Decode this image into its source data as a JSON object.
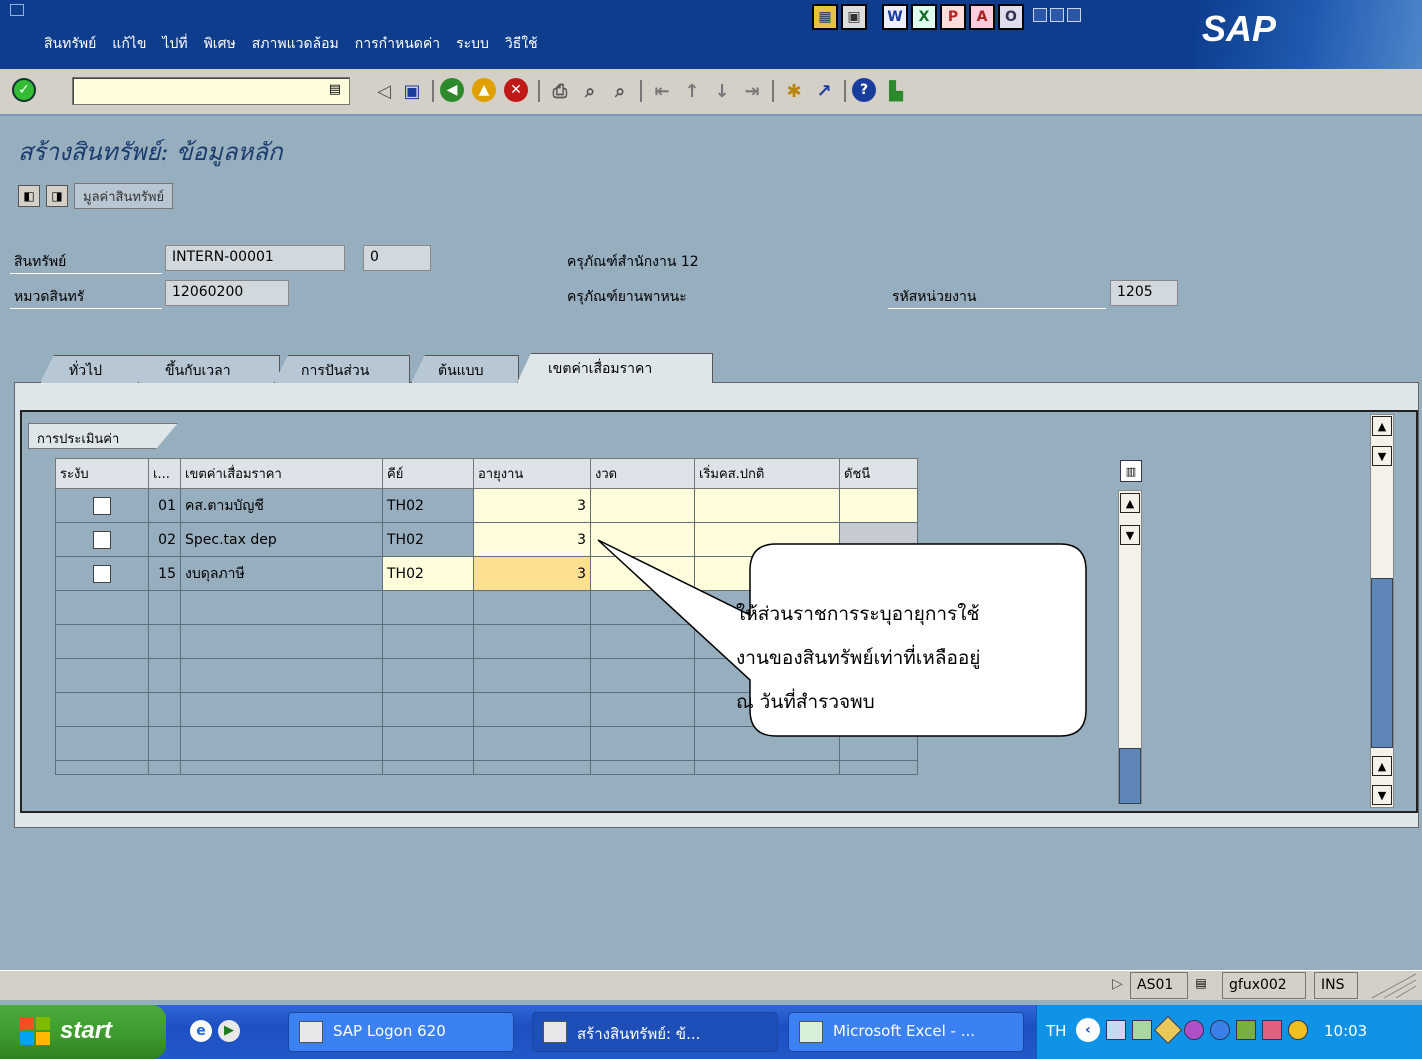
{
  "menubar": {
    "items": [
      "สินทรัพย์",
      "แก้ไข",
      "ไปที่",
      "พิเศษ",
      "สภาพแวดล้อม",
      "การกำหนดค่า",
      "ระบบ",
      "วิธีใช้"
    ],
    "logo": "SAP"
  },
  "system_toolbar": {
    "command_value": "",
    "icons": [
      "enter-icon",
      "back-icon",
      "save-icon",
      "back-green-icon",
      "exit-icon",
      "cancel-icon",
      "print-icon",
      "find-icon",
      "find-next-icon",
      "first-page-icon",
      "prev-page-icon",
      "next-page-icon",
      "last-page-icon",
      "new-session-icon",
      "shortcut-icon",
      "help-icon",
      "layout-icon"
    ]
  },
  "page": {
    "title": "สร้างสินทรัพย์: ข้อมูลหลัก",
    "app_button_label": "มูลค่าสินทรัพย์"
  },
  "header": {
    "asset_label": "สินทรัพย์",
    "asset_value": "INTERN-00001",
    "sub_number": "0",
    "description": "ครุภัณฑ์สำนักงาน 12",
    "class_label": "หมวดสินทรั",
    "class_value": "12060200",
    "class_description": "ครุภัณฑ์ยานพาหนะ",
    "cost_center_label": "รหัสหน่วยงาน",
    "cost_center_value": "1205"
  },
  "tabs": [
    "ทั่วไป",
    "ขึ้นกับเวลา",
    "การปันส่วน",
    "ต้นแบบ",
    "เขตค่าเสื่อมราคา"
  ],
  "active_tab": "เขตค่าเสื่อมราคา",
  "valuation": {
    "group_label": "การประเมินค่า",
    "columns": [
      "ระงับ",
      "เ...",
      "เขตค่าเสื่อมราคา",
      "คีย์",
      "อายุงาน",
      "งวด",
      "เริ่มคส.ปกติ",
      "ดัชนี"
    ],
    "rows": [
      {
        "area": "01",
        "name": "คส.ตามบัญชี",
        "key": "TH02",
        "life": "3",
        "period": "",
        "start": "",
        "index": ""
      },
      {
        "area": "02",
        "name": "Spec.tax dep",
        "key": "TH02",
        "life": "3",
        "period": "",
        "start": "",
        "index": ""
      },
      {
        "area": "15",
        "name": "งบดุลภาษี",
        "key": "TH02",
        "life": "3",
        "period": "",
        "start": "",
        "index": ""
      }
    ]
  },
  "callout": {
    "lines": [
      "ให้ส่วนราชการระบุอายุการใช้",
      "งานของสินทรัพย์เท่าที่เหลืออยู่",
      "ณ วันที่สำรวจพบ"
    ]
  },
  "status": {
    "transaction": "AS01",
    "server": "gfux002",
    "mode": "INS"
  },
  "taskbar": {
    "start": "start",
    "tasks": [
      "SAP Logon 620",
      "สร้างสินทรัพย์: ข้...",
      "Microsoft Excel - ..."
    ],
    "lang": "TH",
    "time": "10:03"
  },
  "colors": {
    "menubar": "#0e3d8d",
    "background": "#97aebf",
    "input": "#fffddb",
    "highlight": "#ffe090"
  }
}
